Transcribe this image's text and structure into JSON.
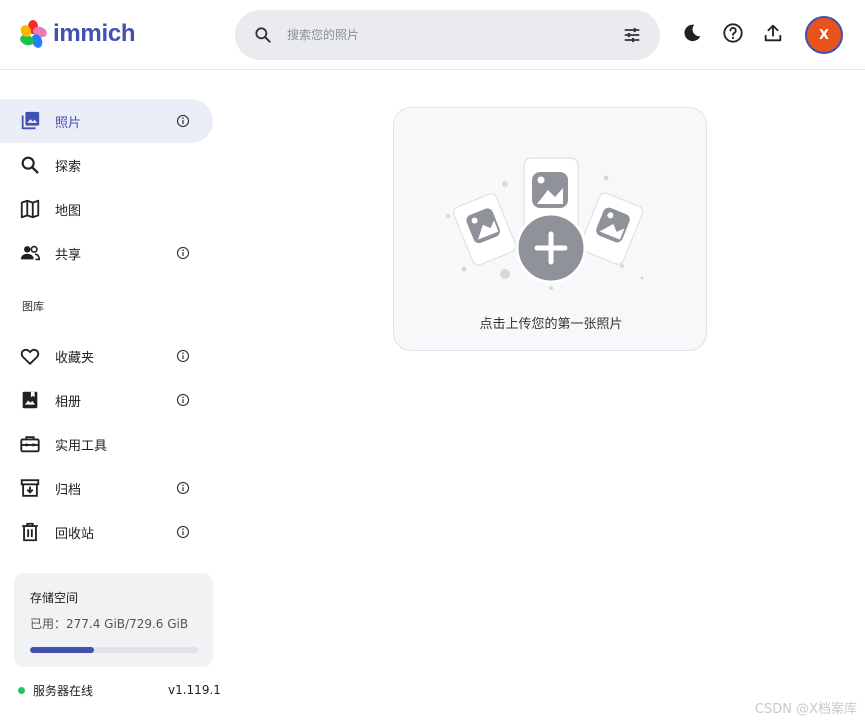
{
  "app": {
    "logo_text": "immich"
  },
  "header": {
    "search_placeholder": "搜索您的照片",
    "icons": {
      "search": "search-icon",
      "filter": "tune-icon",
      "theme": "moon-icon",
      "help": "help-icon",
      "upload": "upload-icon"
    },
    "avatar_initial": "X",
    "avatar_color": "#e8531b"
  },
  "sidebar": {
    "items": [
      {
        "label": "照片",
        "icon": "photos-icon",
        "info": true,
        "active": true
      },
      {
        "label": "探索",
        "icon": "search-icon",
        "info": false
      },
      {
        "label": "地图",
        "icon": "map-icon",
        "info": false
      },
      {
        "label": "共享",
        "icon": "people-icon",
        "info": true
      }
    ],
    "library_section_label": "图库",
    "library_items": [
      {
        "label": "收藏夹",
        "icon": "heart-icon",
        "info": true
      },
      {
        "label": "相册",
        "icon": "album-icon",
        "info": true
      },
      {
        "label": "实用工具",
        "icon": "toolbox-icon",
        "info": false
      },
      {
        "label": "归档",
        "icon": "archive-icon",
        "info": true
      },
      {
        "label": "回收站",
        "icon": "trash-icon",
        "info": true
      }
    ],
    "storage": {
      "title": "存储空间",
      "used_text": "已用：277.4 GiB/729.6 GiB",
      "used_fraction": 0.38
    },
    "server": {
      "status": "服务器在线",
      "version": "v1.119.1"
    }
  },
  "main": {
    "upload_prompt": "点击上传您的第一张照片"
  },
  "watermark": "CSDN @X档案库",
  "colors": {
    "accent": "#4250af",
    "active_bg": "#eceef7",
    "online": "#22c55e"
  }
}
